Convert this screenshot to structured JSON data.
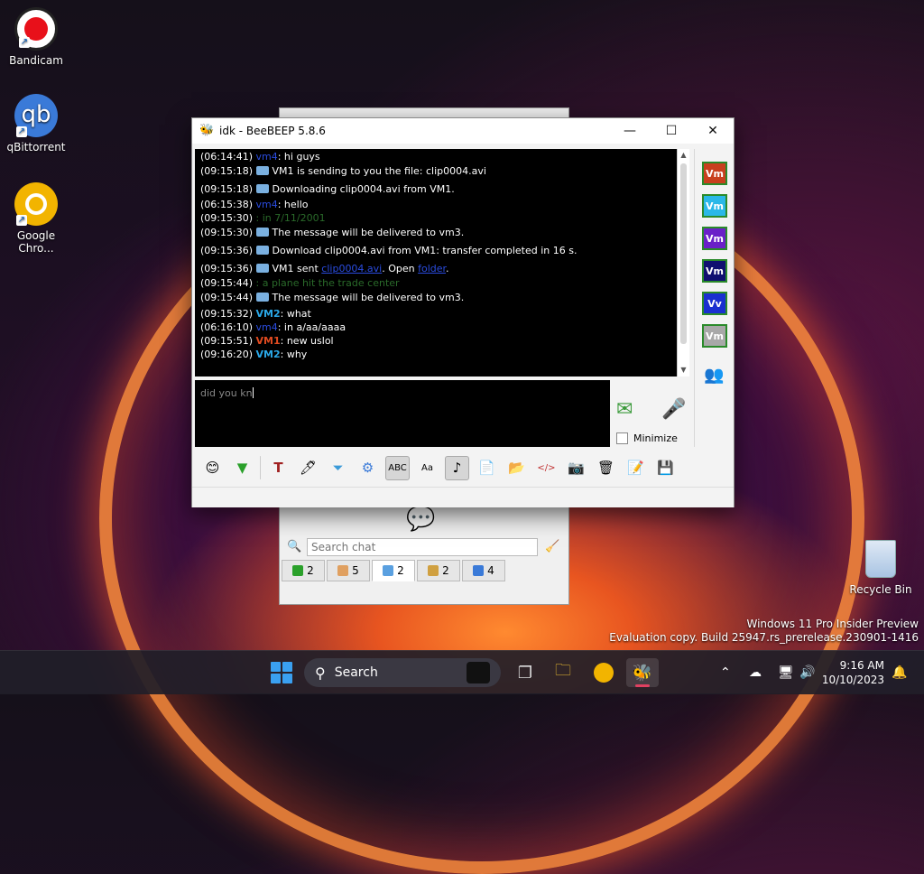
{
  "desktop": {
    "icons": [
      {
        "label": "Bandicam"
      },
      {
        "label": "qBittorrent"
      },
      {
        "label": "Google Chro..."
      }
    ],
    "recycle_bin": "Recycle Bin",
    "watermark_line1": "Windows 11 Pro Insider Preview",
    "watermark_line2": "Evaluation copy. Build 25947.rs_prerelease.230901-1416"
  },
  "chat_window": {
    "title": "idk - BeeBEEP 5.8.6",
    "messages": [
      {
        "ts": "(06:14:41)",
        "text": ": hi guys"
      },
      {
        "ts": "(09:15:18)",
        "text": "VM1 is sending to you the file: clip0004.avi"
      },
      {
        "ts": "(09:15:18)",
        "text": "Downloading clip0004.avi from VM1."
      },
      {
        "ts": "(06:15:38)",
        "text": ": hello"
      },
      {
        "ts": "(09:15:30)",
        "text": ": in 7/11/2001"
      },
      {
        "ts": "(09:15:30)",
        "text": "The message will be delivered to vm3."
      },
      {
        "ts": "(09:15:36)",
        "text": "Download clip0004.avi from VM1: transfer completed in 16 s."
      },
      {
        "ts": "(09:15:36)",
        "text_pre": "VM1 sent ",
        "link1": "clip0004.avi",
        "text_mid": ". Open ",
        "link2": "folder",
        "text_post": "."
      },
      {
        "ts": "(09:15:44)",
        "text": ": a plane hit the trade center"
      },
      {
        "ts": "(09:15:44)",
        "text": "The message will be delivered to vm3."
      },
      {
        "ts": "(09:15:32)",
        "user": "VM2",
        "text": ": what"
      },
      {
        "ts": "(06:16:10)",
        "user": "vm4",
        "text": ": in a/aa/aaaa"
      },
      {
        "ts": "(09:15:51)",
        "user": "VM1",
        "text": ": new uslol"
      },
      {
        "ts": "(09:16:20)",
        "user": "VM2",
        "text": ": why"
      }
    ],
    "input_value": "did you kn",
    "minimize_label": "Minimize",
    "user_badges": [
      {
        "label": "Vm",
        "color": "#c8401e"
      },
      {
        "label": "Vm",
        "color": "#2ab8e8"
      },
      {
        "label": "Vm",
        "color": "#6a20c8"
      },
      {
        "label": "Vm",
        "color": "#101070"
      },
      {
        "label": "Vv",
        "color": "#1a30d0"
      },
      {
        "label": "Vm",
        "color": "#a8a8a8"
      }
    ]
  },
  "back_window": {
    "search_placeholder": "Search chat",
    "tabs": [
      {
        "count": "2"
      },
      {
        "count": "5"
      },
      {
        "count": "2"
      },
      {
        "count": "2"
      },
      {
        "count": "4"
      }
    ]
  },
  "taskbar": {
    "search_label": "Search",
    "time": "9:16 AM",
    "date": "10/10/2023"
  }
}
